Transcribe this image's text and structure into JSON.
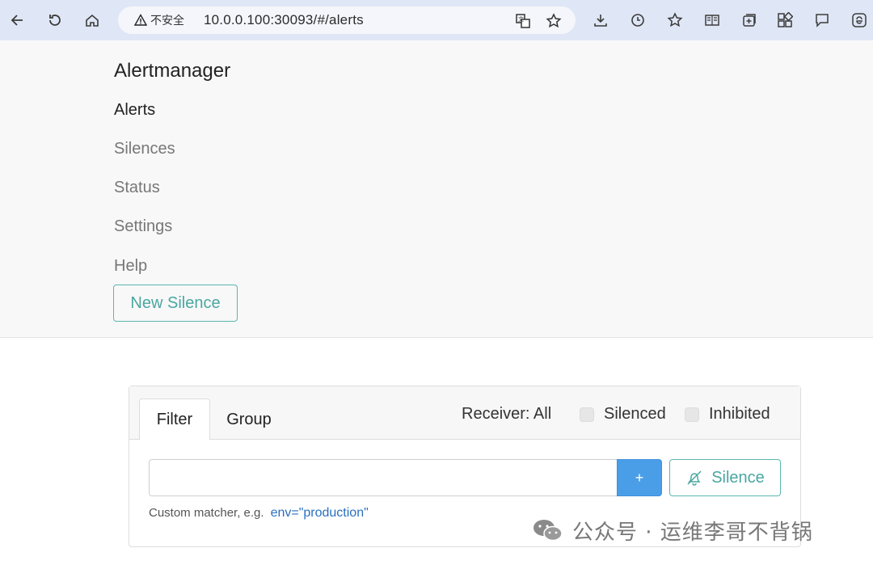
{
  "browser": {
    "security_label": "不安全",
    "url": "10.0.0.100:30093/#/alerts"
  },
  "nav": {
    "brand": "Alertmanager",
    "links": [
      "Alerts",
      "Silences",
      "Status",
      "Settings",
      "Help"
    ],
    "active": "Alerts",
    "new_silence": "New Silence"
  },
  "alerts_panel": {
    "tabs": [
      "Filter",
      "Group"
    ],
    "active_tab": "Filter",
    "receiver": "Receiver: All",
    "checkboxes": [
      {
        "label": "Silenced",
        "checked": false
      },
      {
        "label": "Inhibited",
        "checked": false
      }
    ],
    "filter_input": {
      "value": "",
      "placeholder": ""
    },
    "add_label": "+",
    "silence_label": "Silence",
    "hint": "Custom matcher, e.g.",
    "hint_example": "env=\"production\""
  },
  "watermark": {
    "text": "公众号 · 运维李哥不背锅"
  },
  "colors": {
    "accent_teal": "#4aa7a1",
    "primary_blue": "#4a9ee8",
    "browser_bar": "#dfe6f5"
  }
}
